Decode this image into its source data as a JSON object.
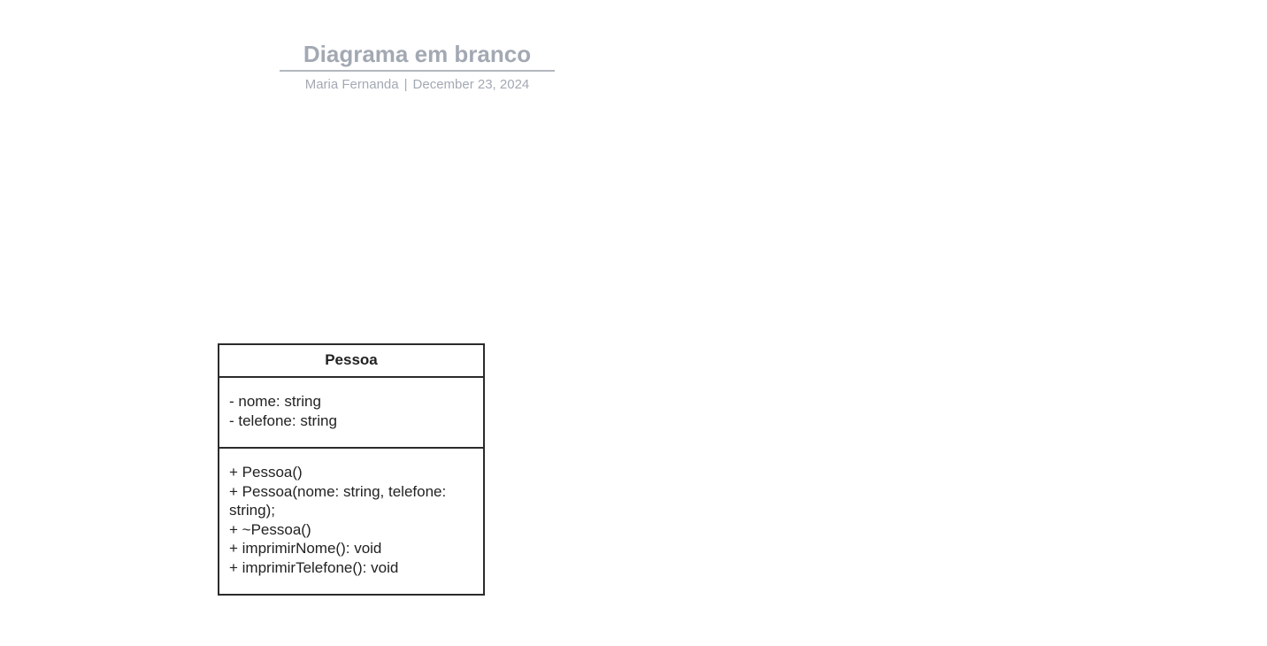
{
  "document": {
    "title": "Diagrama em branco",
    "author": "Maria Fernanda",
    "separator": "|",
    "date": "December 23, 2024"
  },
  "uml_class": {
    "name": "Pessoa",
    "attributes": [
      "- nome: string",
      "- telefone: string"
    ],
    "operations": [
      "+ Pessoa()",
      "+ Pessoa(nome: string, telefone: string);",
      "+ ~Pessoa()",
      "+ imprimirNome(): void",
      "+ imprimirTelefone(): void"
    ]
  }
}
